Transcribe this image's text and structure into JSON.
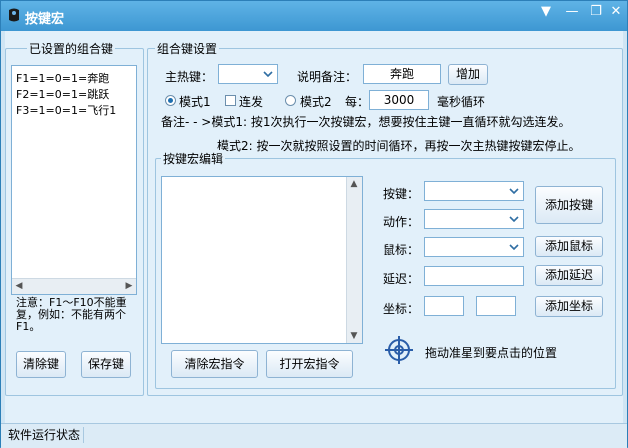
{
  "window": {
    "title": "按键宏",
    "status": "软件运行状态"
  },
  "left_panel": {
    "title": "已设置的组合键",
    "items": [
      "F1=1=0=1=奔跑",
      "F2=1=0=1=跳跃",
      "F3=1=0=1=飞行1"
    ],
    "note": "注意：F1～F10不能重复，例如：不能有两个F1。",
    "clear_label": "清除键",
    "save_label": "保存键"
  },
  "settings": {
    "title": "组合键设置",
    "hotkey_label": "主热键：",
    "hotkey_value": "",
    "remark_label": "说明备注：",
    "remark_value": "奔跑",
    "add_label": "增加",
    "mode1_label": "模式1",
    "mode1_selected": true,
    "repeat_label": "连发",
    "repeat_checked": false,
    "mode2_label": "模式2",
    "mode2_selected": false,
    "interval_label": "每：",
    "interval_value": "3000",
    "interval_unit": "毫秒循环",
    "remark_line1": "备注- - >模式1: 按1次执行一次按键宏，想要按住主键一直循环就勾选连发。",
    "remark_line2": "模式2: 按一次就按照设置的时间循环，再按一次主热键按键宏停止。"
  },
  "macro_editor": {
    "title": "按键宏编辑",
    "key_label": "按键：",
    "action_label": "动作：",
    "mouse_label": "鼠标：",
    "delay_label": "延迟：",
    "coord_label": "坐标：",
    "key_value": "",
    "action_value": "",
    "mouse_value": "",
    "delay_value": "",
    "coord_x": "",
    "coord_y": "",
    "add_key_label": "添加按键",
    "add_mouse_label": "添加鼠标",
    "add_delay_label": "添加延迟",
    "add_coord_label": "添加坐标",
    "clear_macro_label": "清除宏指令",
    "open_macro_label": "打开宏指令",
    "drag_hint": "拖动准星到要点击的位置"
  },
  "colors": {
    "titlebar": "#3d97d2",
    "panel_bg": "#e2f0fa",
    "accent": "#1e6fb0",
    "crosshair": "#2a5da8"
  }
}
